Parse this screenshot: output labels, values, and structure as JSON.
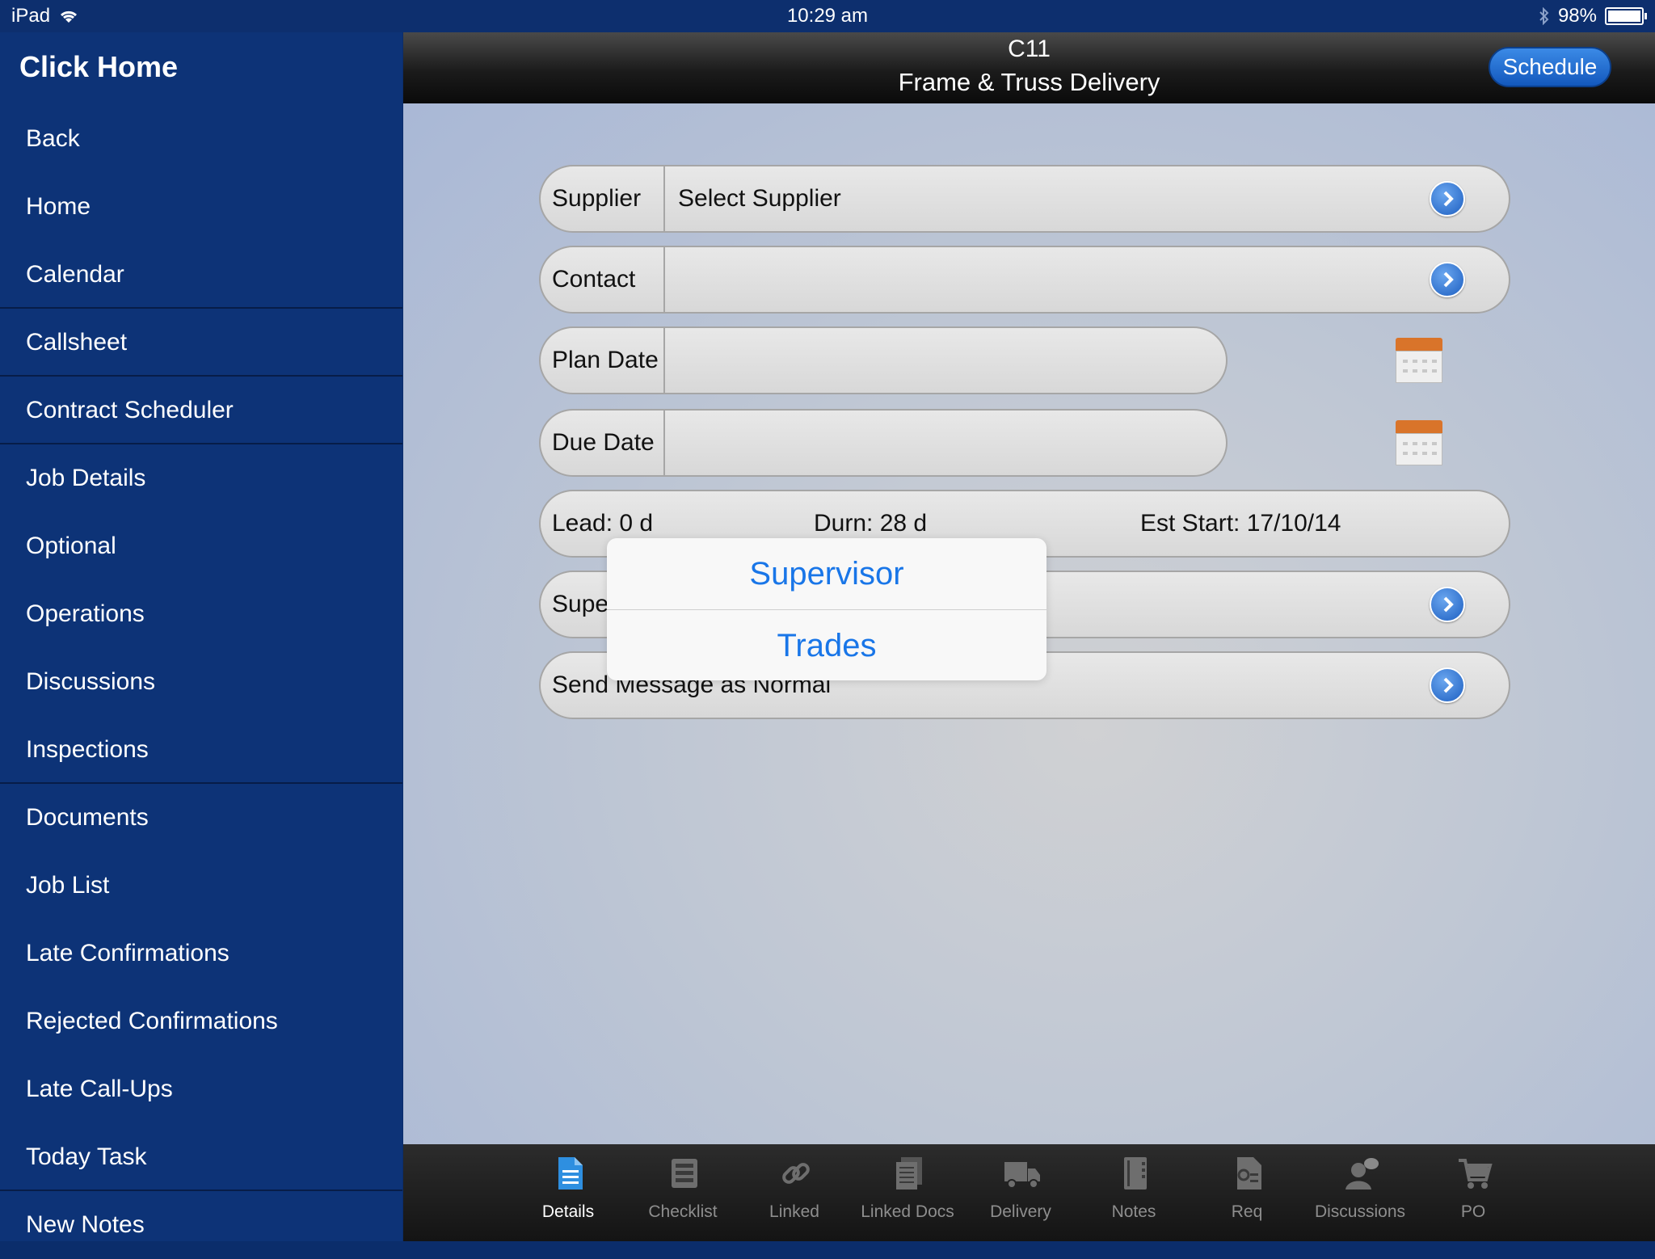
{
  "status": {
    "device": "iPad",
    "time": "10:29 am",
    "battery": "98%",
    "battery_level": 0.98
  },
  "sidebar": {
    "title": "Click Home",
    "items": [
      {
        "label": "Back"
      },
      {
        "label": "Home"
      },
      {
        "label": "Calendar"
      },
      {
        "label": "Callsheet"
      },
      {
        "label": "Contract Scheduler"
      },
      {
        "label": "Job Details"
      },
      {
        "label": "Optional"
      },
      {
        "label": "Operations"
      },
      {
        "label": "Discussions"
      },
      {
        "label": "Inspections"
      },
      {
        "label": "Documents"
      },
      {
        "label": "Job List"
      },
      {
        "label": "Late Confirmations"
      },
      {
        "label": "Rejected Confirmations"
      },
      {
        "label": "Late Call-Ups"
      },
      {
        "label": "Today Task"
      },
      {
        "label": "New Notes"
      }
    ]
  },
  "header": {
    "code": "C11",
    "title": "Frame & Truss Delivery",
    "schedule_label": "Schedule"
  },
  "form": {
    "supplier": {
      "label": "Supplier",
      "value": "Select Supplier"
    },
    "contact": {
      "label": "Contact",
      "value": ""
    },
    "plan_date": {
      "label": "Plan Date",
      "value": ""
    },
    "due_date": {
      "label": "Due Date",
      "value": ""
    },
    "lead": "Lead: 0 d",
    "durn": "Durn: 28 d",
    "est_start": "Est Start: 17/10/14",
    "supervisor": {
      "label": "Supervisor"
    },
    "send_message": {
      "label": "Send Message as Normal"
    }
  },
  "popover": {
    "options": [
      "Supervisor",
      "Trades"
    ]
  },
  "tabs": [
    {
      "label": "Details",
      "icon": "document-icon",
      "active": true
    },
    {
      "label": "Checklist",
      "icon": "checklist-icon"
    },
    {
      "label": "Linked",
      "icon": "link-icon"
    },
    {
      "label": "Linked Docs",
      "icon": "linked-docs-icon"
    },
    {
      "label": "Delivery",
      "icon": "truck-icon"
    },
    {
      "label": "Notes",
      "icon": "notebook-icon"
    },
    {
      "label": "Req",
      "icon": "request-icon"
    },
    {
      "label": "Discussions",
      "icon": "discussion-icon"
    },
    {
      "label": "PO",
      "icon": "cart-icon"
    }
  ],
  "colors": {
    "sidebar": "#0d3377",
    "accent": "#1976e8",
    "active_tab": "#2e8fe0"
  }
}
